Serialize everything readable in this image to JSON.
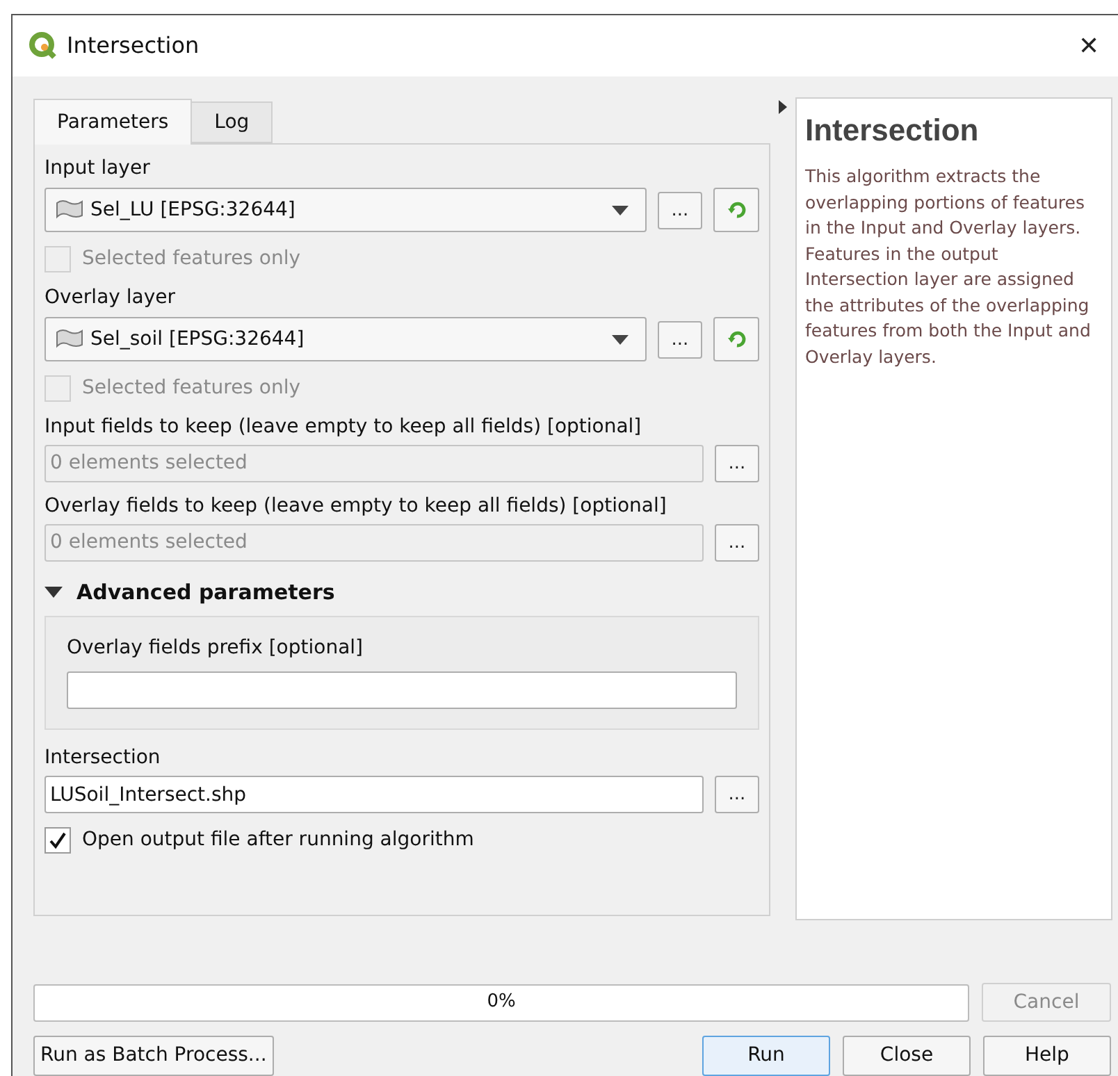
{
  "window": {
    "title": "Intersection",
    "close": "✕"
  },
  "tabs": [
    {
      "label": "Parameters",
      "selected": true
    },
    {
      "label": "Log",
      "selected": false
    }
  ],
  "parameters": [
    {
      "kind": "layer",
      "label": "Input layer",
      "value": "Sel_LU [EPSG:32644]",
      "button": "...",
      "option": {
        "label": "Selected features only",
        "checked": false,
        "disabled": true
      }
    },
    {
      "kind": "layer",
      "label": "Overlay layer",
      "value": "Sel_soil [EPSG:32644]",
      "button": "...",
      "option": {
        "label": "Selected features only",
        "checked": false,
        "disabled": true
      }
    },
    {
      "kind": "fields",
      "label": "Input fields to keep (leave empty to keep all fields) [optional]",
      "value": "0 elements selected",
      "button": "..."
    },
    {
      "kind": "fields",
      "label": "Overlay fields to keep (leave empty to keep all fields) [optional]",
      "value": "0 elements selected",
      "button": "..."
    }
  ],
  "advanced": {
    "label": "Advanced parameters",
    "expanded": true,
    "fields": [
      {
        "label": "Overlay fields prefix [optional]"
      }
    ]
  },
  "output": {
    "label": "Intersection",
    "value": "LUSoil_Intersect.shp",
    "button": "...",
    "option": {
      "label": "Open output file after running algorithm",
      "checked": true,
      "disabled": false
    }
  },
  "help": {
    "title": "Intersection",
    "text": "This algorithm extracts the overlapping portions of features in the Input and Overlay layers. Features in the output Intersection layer are assigned the attributes of the overlapping features from both the Input and Overlay layers."
  },
  "progress": {
    "level": 0,
    "reading": "0%"
  },
  "cancel": {
    "label": "Cancel",
    "disabled": true
  },
  "buttons": [
    {
      "label": "Run as Batch Process...",
      "kind": "batch"
    },
    {
      "label": "Run",
      "kind": "default"
    },
    {
      "label": "Close",
      "kind": "normal"
    },
    {
      "label": "Help",
      "kind": "normal"
    }
  ]
}
